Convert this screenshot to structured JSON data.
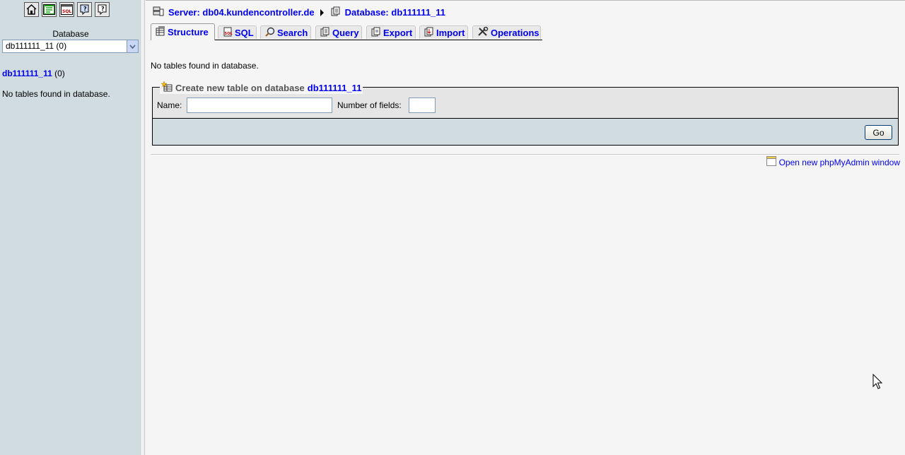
{
  "left": {
    "icons": [
      {
        "name": "home-icon"
      },
      {
        "name": "query-window-icon"
      },
      {
        "name": "sql-icon"
      },
      {
        "name": "documentation-icon"
      },
      {
        "name": "sql-documentation-icon"
      }
    ],
    "database_label": "Database",
    "database_select_value": "db111111_11 (0)",
    "db_name": "db111111_11",
    "db_count": "(0)",
    "no_tables": "No tables found in database."
  },
  "breadcrumb": {
    "server": "Server: db04.kundencontroller.de",
    "database": "Database: db111111_11"
  },
  "tabs": [
    {
      "label": "Structure",
      "icon": "structure-icon",
      "active": true
    },
    {
      "label": "SQL",
      "icon": "sql-icon"
    },
    {
      "label": "Search",
      "icon": "search-icon"
    },
    {
      "label": "Query",
      "icon": "query-icon"
    },
    {
      "label": "Export",
      "icon": "export-icon"
    },
    {
      "label": "Import",
      "icon": "import-icon"
    },
    {
      "label": "Operations",
      "icon": "operations-icon"
    }
  ],
  "main": {
    "no_tables": "No tables found in database.",
    "create_table": {
      "legend_prefix": "Create new table on database",
      "legend_db": "db111111_11",
      "name_label": "Name:",
      "name_value": "",
      "fields_label": "Number of fields:",
      "fields_value": "",
      "go_label": "Go"
    },
    "open_window_link": "Open new phpMyAdmin window"
  },
  "colors": {
    "left_bg": "#d0dce0",
    "main_bg": "#f5f5f5",
    "link": "#0000ee"
  }
}
